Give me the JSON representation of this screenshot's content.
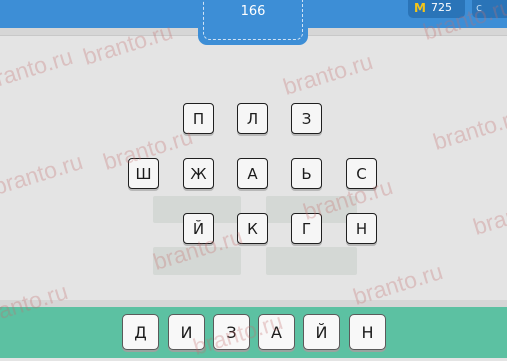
{
  "header": {
    "level": "166",
    "coins_icon": "M",
    "coins": "725",
    "menu_label": "с"
  },
  "board": {
    "rows": [
      [
        "П",
        "Л",
        "З"
      ],
      [
        "Ш",
        "Ж",
        "А",
        "Ь",
        "С"
      ],
      [
        "Й",
        "К",
        "Г",
        "Н"
      ]
    ]
  },
  "answer": {
    "letters": [
      "Д",
      "И",
      "З",
      "А",
      "Й",
      "Н"
    ]
  },
  "watermark": "branto.ru",
  "colors": {
    "topbar": "#3d8ed6",
    "bottombar": "#5cc1a2",
    "background": "#e4e4e4",
    "coin": "#f5c518"
  }
}
